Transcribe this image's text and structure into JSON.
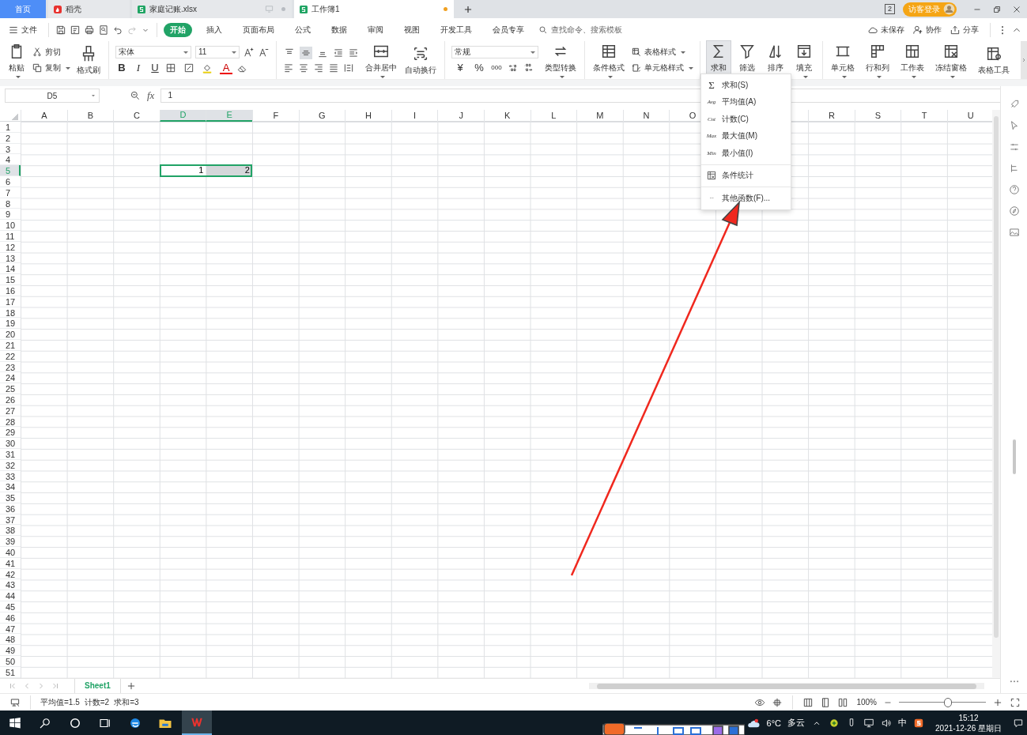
{
  "tabs": [
    {
      "label": "首页",
      "kind": "home",
      "selected": false
    },
    {
      "label": "稻壳",
      "kind": "docer",
      "selected": false
    },
    {
      "label": "家庭记账.xlsx",
      "kind": "sheet",
      "selected": false
    },
    {
      "label": "工作簿1",
      "kind": "sheet",
      "selected": true
    }
  ],
  "title_bar": {
    "badge": "2",
    "login": "访客登录"
  },
  "menu": {
    "file": "文件",
    "items": [
      {
        "label": "开始",
        "selected": true
      },
      {
        "label": "插入",
        "selected": false
      },
      {
        "label": "页面布局",
        "selected": false
      },
      {
        "label": "公式",
        "selected": false
      },
      {
        "label": "数据",
        "selected": false
      },
      {
        "label": "审阅",
        "selected": false
      },
      {
        "label": "视图",
        "selected": false
      },
      {
        "label": "开发工具",
        "selected": false
      },
      {
        "label": "会员专享",
        "selected": false
      }
    ],
    "search": {
      "placeholder": "查找命令、搜索模板"
    },
    "actions": [
      "未保存",
      "协作",
      "分享"
    ]
  },
  "ribbon": {
    "clipboard": {
      "paste": "粘贴",
      "cut": "剪切",
      "copy": "复制",
      "format_painter": "格式刷"
    },
    "font": {
      "name": "宋体",
      "size": "11",
      "bold": "B",
      "italic": "I",
      "underline": "U",
      "font_color_button": "A"
    },
    "vertical_align": [
      {
        "selected": false
      },
      {
        "selected": true
      },
      {
        "selected": false
      }
    ],
    "alignment": {
      "merge": "合并居中",
      "wrap": "自动换行"
    },
    "number": {
      "format": "常规",
      "currency": "¥",
      "percent": "%",
      "thousands": "000",
      "convert": "类型转换"
    },
    "styles": {
      "conditional": "条件格式",
      "table_style": "表格样式",
      "cell_style": "单元格样式"
    },
    "editing": [
      {
        "label": "求和",
        "selected": true
      },
      {
        "label": "筛选",
        "selected": false
      },
      {
        "label": "排序",
        "selected": false
      },
      {
        "label": "填充",
        "selected": false
      }
    ],
    "cells": [
      "单元格",
      "行和列",
      "工作表",
      "冻结窗格",
      "表格工具"
    ]
  },
  "formula_bar": {
    "name_box": "D5",
    "fx": "fx",
    "value": "1"
  },
  "sheet": {
    "columns": [
      {
        "label": "A",
        "selected": false
      },
      {
        "label": "B",
        "selected": false
      },
      {
        "label": "C",
        "selected": false
      },
      {
        "label": "D",
        "selected": true
      },
      {
        "label": "E",
        "selected": true
      },
      {
        "label": "F",
        "selected": false
      },
      {
        "label": "G",
        "selected": false
      },
      {
        "label": "H",
        "selected": false
      },
      {
        "label": "I",
        "selected": false
      },
      {
        "label": "J",
        "selected": false
      },
      {
        "label": "K",
        "selected": false
      },
      {
        "label": "L",
        "selected": false
      },
      {
        "label": "M",
        "selected": false
      },
      {
        "label": "N",
        "selected": false
      },
      {
        "label": "O",
        "selected": false
      },
      null,
      null,
      {
        "label": "R",
        "selected": false
      },
      {
        "label": "S",
        "selected": false
      },
      {
        "label": "T",
        "selected": false
      },
      {
        "label": "U",
        "selected": false
      }
    ],
    "rows": [
      {
        "label": "1",
        "selected": false
      },
      {
        "label": "2",
        "selected": false
      },
      {
        "label": "3",
        "selected": false
      },
      {
        "label": "4",
        "selected": false
      },
      {
        "label": "5",
        "selected": true,
        "cells": [
          null,
          null,
          null,
          {
            "value": "1",
            "active": true,
            "selected": true
          },
          {
            "value": "2",
            "active": false,
            "selected": true
          }
        ]
      },
      {
        "label": "6",
        "selected": false
      },
      {
        "label": "7",
        "selected": false
      },
      {
        "label": "8",
        "selected": false
      },
      {
        "label": "9",
        "selected": false
      },
      {
        "label": "10",
        "selected": false
      },
      {
        "label": "11",
        "selected": false
      },
      {
        "label": "12",
        "selected": false
      },
      {
        "label": "13",
        "selected": false
      },
      {
        "label": "14",
        "selected": false
      },
      {
        "label": "15",
        "selected": false
      },
      {
        "label": "16",
        "selected": false
      },
      {
        "label": "17",
        "selected": false
      },
      {
        "label": "18",
        "selected": false
      },
      {
        "label": "19",
        "selected": false
      },
      {
        "label": "20",
        "selected": false
      },
      {
        "label": "21",
        "selected": false
      },
      {
        "label": "22",
        "selected": false
      },
      {
        "label": "23",
        "selected": false
      },
      {
        "label": "24",
        "selected": false
      },
      {
        "label": "25",
        "selected": false
      },
      {
        "label": "26",
        "selected": false
      },
      {
        "label": "27",
        "selected": false
      },
      {
        "label": "28",
        "selected": false
      },
      {
        "label": "29",
        "selected": false
      },
      {
        "label": "30",
        "selected": false
      },
      {
        "label": "31",
        "selected": false
      },
      {
        "label": "32",
        "selected": false
      },
      {
        "label": "33",
        "selected": false
      },
      {
        "label": "34",
        "selected": false
      },
      {
        "label": "35",
        "selected": false
      },
      {
        "label": "36",
        "selected": false
      },
      {
        "label": "37",
        "selected": false
      },
      {
        "label": "38",
        "selected": false
      },
      {
        "label": "39",
        "selected": false
      },
      {
        "label": "40",
        "selected": false
      },
      {
        "label": "41",
        "selected": false
      },
      {
        "label": "42",
        "selected": false
      },
      {
        "label": "43",
        "selected": false
      },
      {
        "label": "44",
        "selected": false
      },
      {
        "label": "45",
        "selected": false
      },
      {
        "label": "46",
        "selected": false
      },
      {
        "label": "47",
        "selected": false
      },
      {
        "label": "48",
        "selected": false
      },
      {
        "label": "49",
        "selected": false
      },
      {
        "label": "50",
        "selected": false
      },
      {
        "label": "51",
        "selected": false
      }
    ]
  },
  "dropdown": {
    "sections": [
      [
        {
          "mark": "Σ",
          "label": "求和(S)"
        },
        {
          "mark": "Avg",
          "label": "平均值(A)"
        },
        {
          "mark": "Cnt",
          "label": "计数(C)"
        },
        {
          "mark": "Max",
          "label": "最大值(M)"
        },
        {
          "mark": "Min",
          "label": "最小值(I)"
        }
      ],
      [
        {
          "kind": "icon",
          "label": "条件统计"
        }
      ],
      [
        {
          "mark": "···",
          "label": "其他函数(F)..."
        }
      ]
    ]
  },
  "sheet_tabs": [
    {
      "label": "Sheet1",
      "selected": true
    }
  ],
  "status_bar": {
    "stats": [
      "平均值=1.5",
      "计数=2",
      "求和=3"
    ],
    "zoom": "100%",
    "zoom_slider": {
      "level": 0.55
    }
  },
  "taskbar": {
    "temperature": "6°C",
    "weather": "多云",
    "ime": "中",
    "time": "15:12",
    "date": "2021-12-26 星期日"
  }
}
